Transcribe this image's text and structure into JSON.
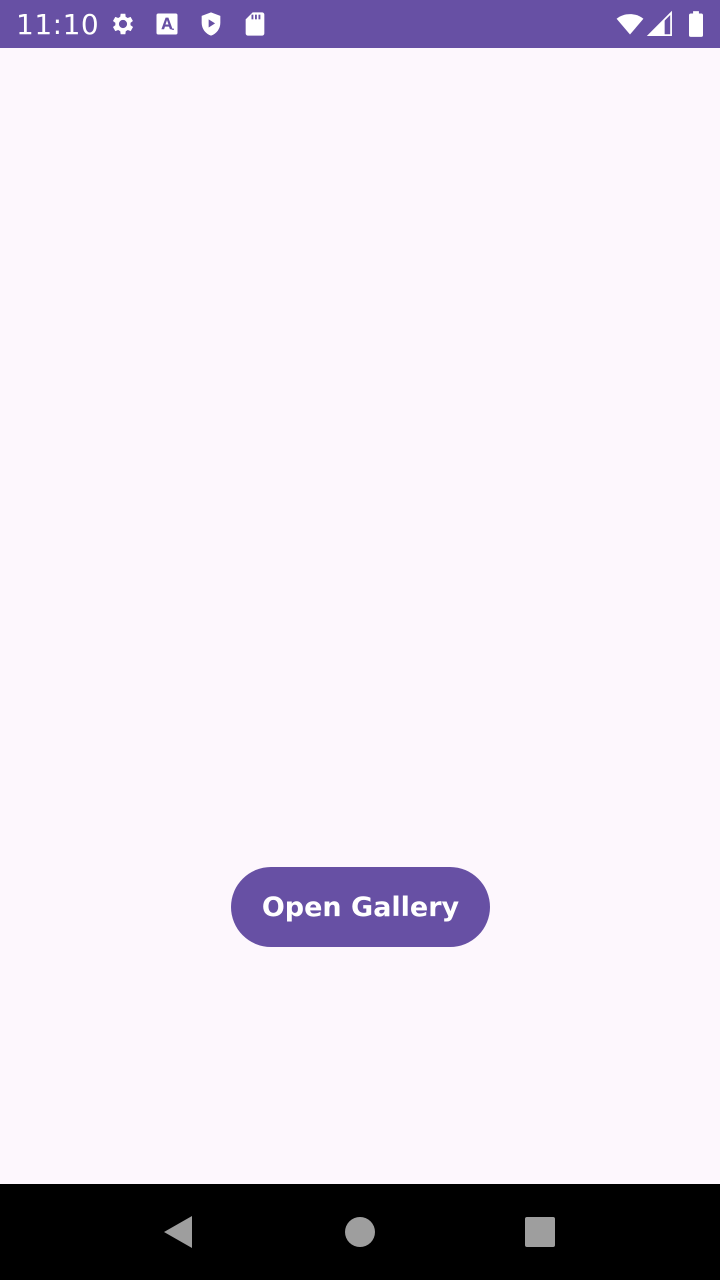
{
  "status_bar": {
    "time": "11:10",
    "background_color": "#6750A4",
    "left_icons": [
      "settings-gear-icon",
      "font-a-icon",
      "play-protect-icon",
      "sd-card-icon"
    ],
    "right_icons": [
      "wifi-icon",
      "cell-signal-icon",
      "battery-icon"
    ]
  },
  "main": {
    "open_gallery_label": "Open Gallery",
    "button_color": "#6750A4",
    "background_color": "#FDF7FD"
  },
  "nav_bar": {
    "buttons": [
      "back-icon",
      "home-icon",
      "recents-icon"
    ]
  }
}
